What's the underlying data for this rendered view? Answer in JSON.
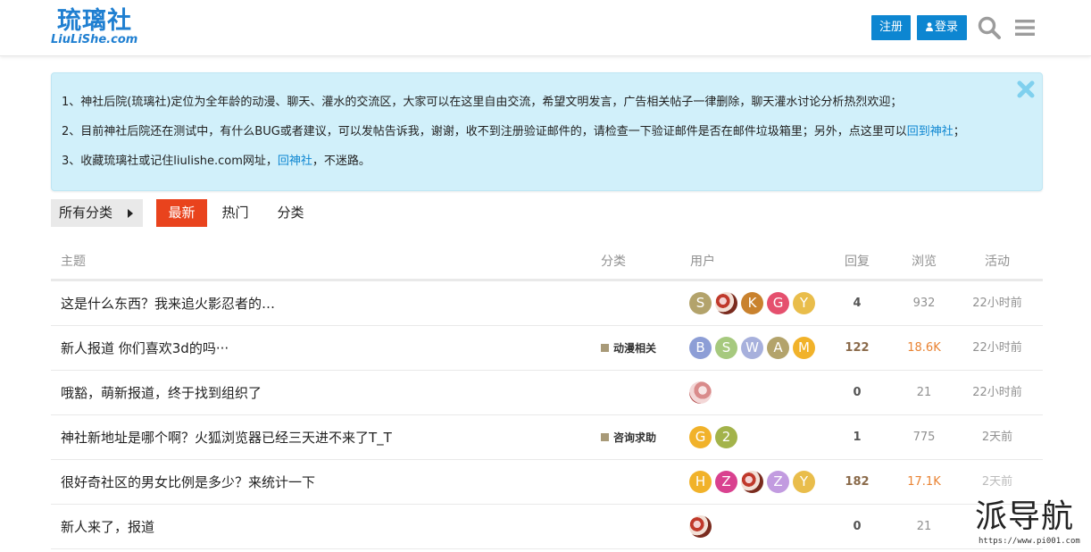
{
  "header": {
    "logo_cn": "琉璃社",
    "logo_en": "LiuLiShe.com",
    "register_label": "注册",
    "login_label": "登录"
  },
  "notice": {
    "line1": "1、神社后院(琉璃社)定位为全年龄的动漫、聊天、灌水的交流区，大家可以在这里自由交流，希望文明发言，广告相关帖子一律删除，聊天灌水讨论分析热烈欢迎；",
    "line2_text": "2、目前神社后院还在测试中，有什么BUG或者建议，可以发帖告诉我，谢谢，收不到注册验证邮件的，请检查一下验证邮件是否在邮件垃圾箱里；另外，点这里可以",
    "line2_link": "回到神社",
    "line2_end": "；",
    "line3_text": "3、收藏琉璃社或记住liulishe.com网址，",
    "line3_link": "回神社",
    "line3_end": "，不迷路。"
  },
  "nav": {
    "all_categories": "所有分类",
    "latest": "最新",
    "hot": "热门",
    "categories": "分类"
  },
  "table": {
    "headers": {
      "topic": "主题",
      "category": "分类",
      "users": "用户",
      "replies": "回复",
      "views": "浏览",
      "activity": "活动"
    },
    "rows": [
      {
        "title": "这是什么东西？我来追火影忍者的…",
        "category": "",
        "replies": "4",
        "views": "932",
        "activity": "22小时前",
        "avatars": [
          {
            "letter": "S",
            "color": "#b3a36b"
          },
          {
            "letter": "",
            "color": "image"
          },
          {
            "letter": "K",
            "color": "#c9822e"
          },
          {
            "letter": "G",
            "color": "#e5506e"
          },
          {
            "letter": "Y",
            "color": "#e9bd4b"
          }
        ]
      },
      {
        "title": "新人报道 你们喜欢3d的吗···",
        "category": "动漫相关",
        "replies": "122",
        "views": "18.6K",
        "activity": "22小时前",
        "avatars": [
          {
            "letter": "B",
            "color": "#8d9ed6"
          },
          {
            "letter": "S",
            "color": "#a6c97e"
          },
          {
            "letter": "W",
            "color": "#a7b0dc"
          },
          {
            "letter": "A",
            "color": "#b3a36b"
          },
          {
            "letter": "M",
            "color": "#f1b22a"
          }
        ]
      },
      {
        "title": "哦豁，萌新报道，终于找到组织了",
        "category": "",
        "replies": "0",
        "views": "21",
        "activity": "22小时前",
        "avatars": [
          {
            "letter": "",
            "color": "image2"
          }
        ]
      },
      {
        "title": "神社新地址是哪个啊？火狐浏览器已经三天进不来了T_T",
        "category": "咨询求助",
        "replies": "1",
        "views": "775",
        "activity": "2天前",
        "avatars": [
          {
            "letter": "G",
            "color": "#f1b22a"
          },
          {
            "letter": "2",
            "color": "#a3b34a"
          }
        ]
      },
      {
        "title": "很好奇社区的男女比例是多少？来统计一下",
        "category": "",
        "replies": "182",
        "views": "17.1K",
        "activity": "2天前",
        "avatars": [
          {
            "letter": "H",
            "color": "#f1b22a"
          },
          {
            "letter": "Z",
            "color": "#d9418f"
          },
          {
            "letter": "",
            "color": "image"
          },
          {
            "letter": "Z",
            "color": "#c29be0"
          },
          {
            "letter": "Y",
            "color": "#e9bd4b"
          }
        ]
      },
      {
        "title": "新人来了，报道",
        "category": "",
        "replies": "0",
        "views": "21",
        "activity": "",
        "avatars": [
          {
            "letter": "",
            "color": "image"
          }
        ]
      }
    ]
  },
  "watermark": {
    "cn": "派导航",
    "url": "https://www.pi001.com"
  },
  "colors": {
    "brand_blue": "#0d86d1",
    "latest_tab": "#e9431d",
    "notice_bg": "#d1f0fa",
    "hot_views": "#e98333"
  },
  "icons": [
    "user-icon",
    "search-icon",
    "menu-icon",
    "close-icon",
    "caret-right-icon"
  ]
}
